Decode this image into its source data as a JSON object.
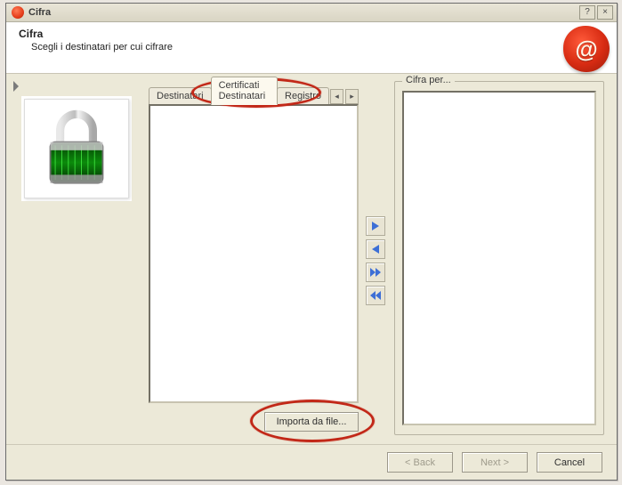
{
  "window": {
    "title": "Cifra",
    "help_glyph": "?",
    "close_glyph": "×"
  },
  "header": {
    "title": "Cifra",
    "subtitle": "Scegli i destinatari per cui cifrare",
    "seal_glyph": "@"
  },
  "tabs": {
    "items": [
      {
        "label": "Destinatari",
        "active": false
      },
      {
        "label": "Certificati Destinatari",
        "active": true
      },
      {
        "label": "Registro",
        "active": false
      }
    ],
    "scroll_left_glyph": "◂",
    "scroll_right_glyph": "▸"
  },
  "import_button_label": "Importa da file...",
  "transfer": {
    "add": "▶",
    "remove": "◀",
    "add_all": "▶▶",
    "remove_all": "◀◀"
  },
  "right_group_title": "Cifra per...",
  "wizard": {
    "back": "< Back",
    "next": "Next >",
    "cancel": "Cancel"
  },
  "icons": {
    "padlock": "padlock-icon",
    "app": "app-icon"
  }
}
